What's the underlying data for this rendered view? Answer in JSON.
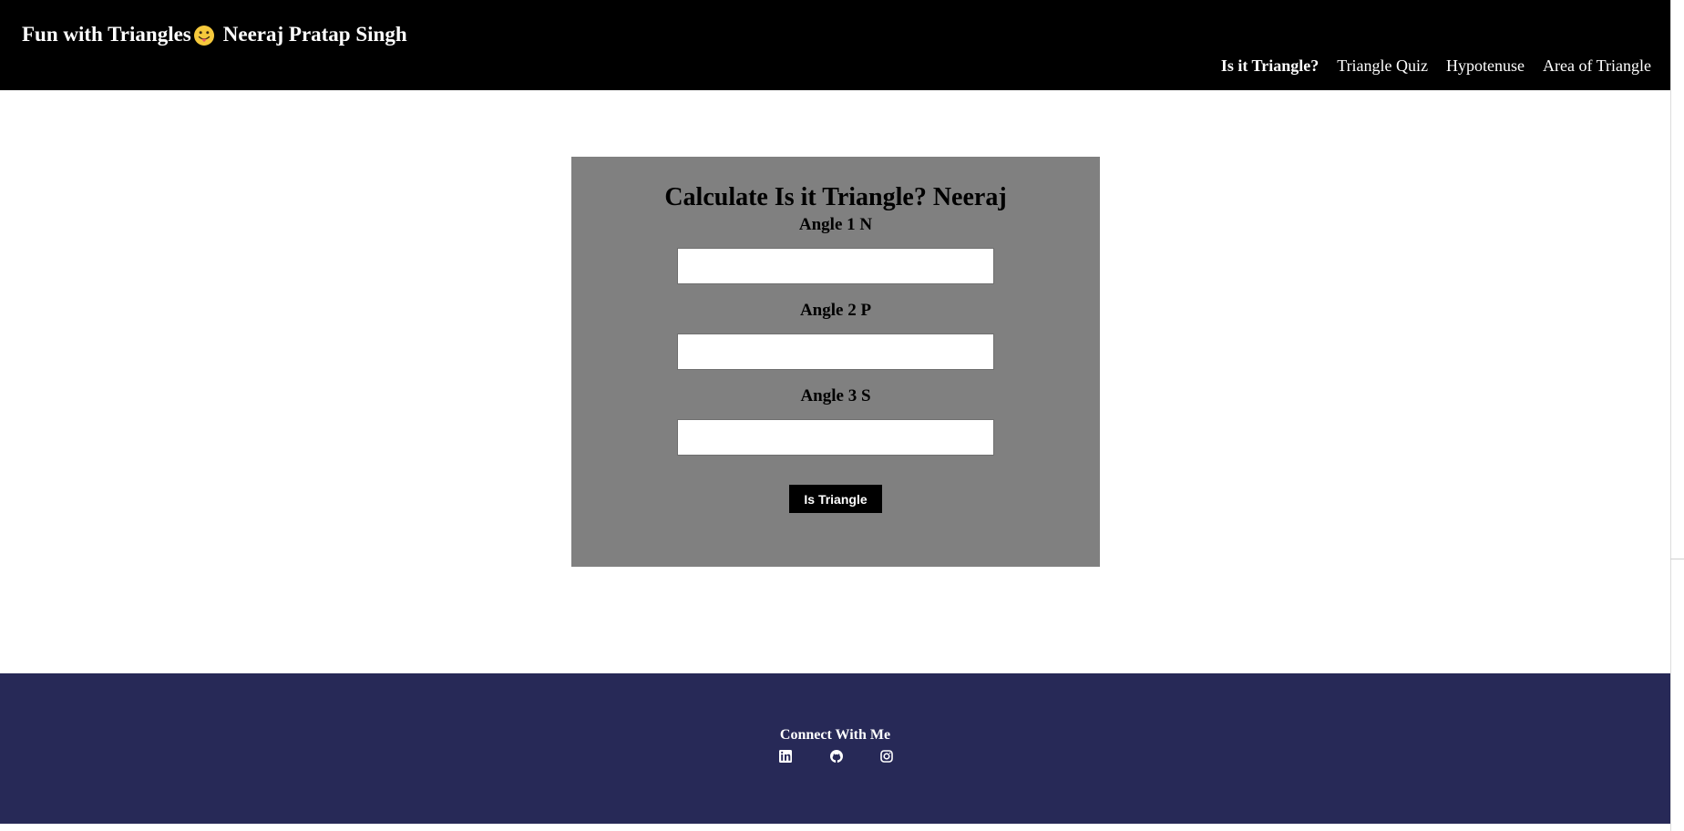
{
  "header": {
    "brand_title": "Fun with Triangles",
    "brand_emoji": "face-with-tongue",
    "brand_name": "Neeraj Pratap Singh",
    "nav": [
      {
        "label": "Is it Triangle?",
        "active": true
      },
      {
        "label": "Triangle Quiz",
        "active": false
      },
      {
        "label": "Hypotenuse",
        "active": false
      },
      {
        "label": "Area of Triangle",
        "active": false
      }
    ]
  },
  "main": {
    "title": "Calculate Is it Triangle? Neeraj",
    "fields": [
      {
        "label": "Angle 1 N",
        "value": "",
        "placeholder": ""
      },
      {
        "label": "Angle 2 P",
        "value": "",
        "placeholder": ""
      },
      {
        "label": "Angle 3 S",
        "value": "",
        "placeholder": ""
      }
    ],
    "button_label": "Is Triangle"
  },
  "footer": {
    "title": "Connect With Me",
    "social_icons": [
      "linkedin-icon",
      "github-icon",
      "instagram-icon"
    ]
  },
  "colors": {
    "header_bg": "#000000",
    "card_bg": "#808080",
    "footer_bg": "#272957",
    "button_bg": "#000000",
    "text_light": "#ffffff"
  }
}
